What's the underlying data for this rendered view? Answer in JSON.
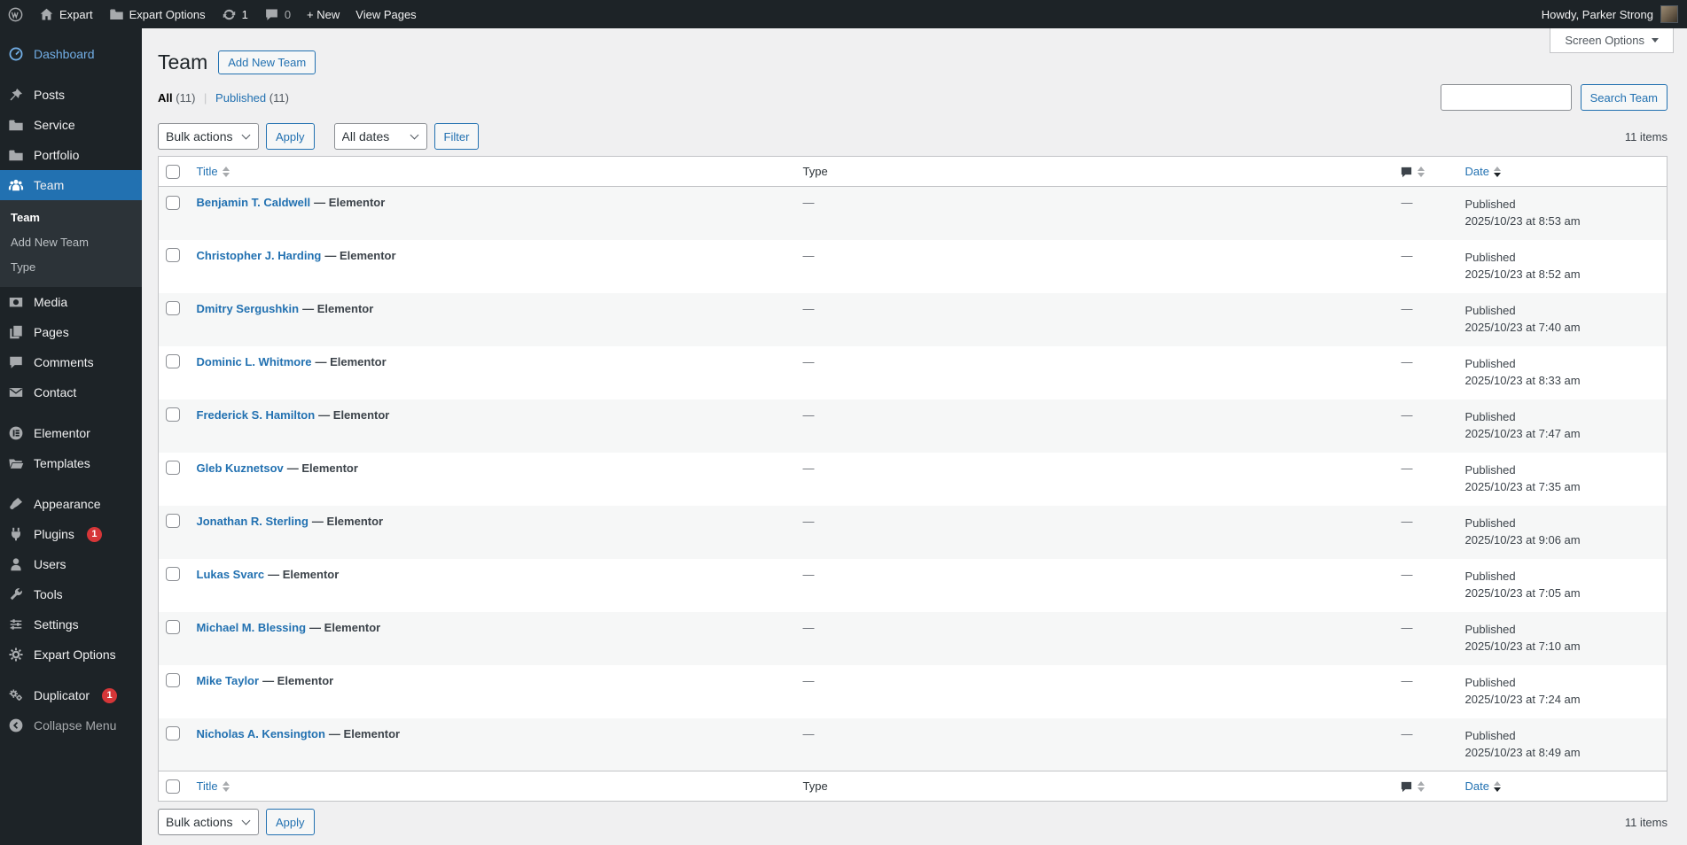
{
  "admin_bar": {
    "site_name": "Expart",
    "site_menu": "Expart Options",
    "update_count": "1",
    "comment_count": "0",
    "new_label": "+ New",
    "view_pages_label": "View Pages",
    "howdy_text": "Howdy, Parker Strong"
  },
  "sidebar": {
    "items": [
      {
        "id": "dashboard",
        "label": "Dashboard",
        "icon": "dashboard-icon",
        "blue": true
      },
      {
        "sep": true
      },
      {
        "id": "posts",
        "label": "Posts",
        "icon": "pushpin-icon"
      },
      {
        "id": "service",
        "label": "Service",
        "icon": "folder-icon"
      },
      {
        "id": "portfolio",
        "label": "Portfolio",
        "icon": "folder-icon"
      },
      {
        "id": "team",
        "label": "Team",
        "icon": "team-icon",
        "active": true,
        "submenu": [
          {
            "label": "Team",
            "current": true
          },
          {
            "label": "Add New Team"
          },
          {
            "label": "Type"
          }
        ]
      },
      {
        "id": "media",
        "label": "Media",
        "icon": "media-icon"
      },
      {
        "id": "pages",
        "label": "Pages",
        "icon": "pages-icon"
      },
      {
        "id": "comments",
        "label": "Comments",
        "icon": "comment-icon"
      },
      {
        "id": "contact",
        "label": "Contact",
        "icon": "envelope-icon"
      },
      {
        "sep": true
      },
      {
        "id": "elementor",
        "label": "Elementor",
        "icon": "elementor-icon"
      },
      {
        "id": "templates",
        "label": "Templates",
        "icon": "folder-open-icon"
      },
      {
        "sep": true
      },
      {
        "id": "appearance",
        "label": "Appearance",
        "icon": "brush-icon"
      },
      {
        "id": "plugins",
        "label": "Plugins",
        "icon": "plug-icon",
        "badge": "1"
      },
      {
        "id": "users",
        "label": "Users",
        "icon": "user-icon"
      },
      {
        "id": "tools",
        "label": "Tools",
        "icon": "wrench-icon"
      },
      {
        "id": "settings",
        "label": "Settings",
        "icon": "sliders-icon"
      },
      {
        "id": "expart-options",
        "label": "Expart Options",
        "icon": "gear-icon"
      },
      {
        "sep": true
      },
      {
        "id": "duplicator",
        "label": "Duplicator",
        "icon": "duplicator-icon",
        "badge": "1"
      },
      {
        "id": "collapse",
        "label": "Collapse Menu",
        "icon": "collapse-icon",
        "muted": true
      }
    ]
  },
  "screen_options": {
    "label": "Screen Options"
  },
  "page": {
    "title": "Team",
    "add_new_label": "Add New Team",
    "views": {
      "all_label": "All",
      "all_count": "(11)",
      "separator": "|",
      "published_label": "Published",
      "published_count": "(11)"
    },
    "search": {
      "button_label": "Search Team"
    },
    "tablenav": {
      "bulk_actions": "Bulk actions",
      "apply": "Apply",
      "all_dates": "All dates",
      "filter": "Filter",
      "items_count": "11 items"
    }
  },
  "table": {
    "columns": {
      "title": "Title",
      "type": "Type",
      "date": "Date"
    },
    "rows": [
      {
        "title": "Benjamin T. Caldwell",
        "state": "— Elementor",
        "type": "—",
        "comments": "—",
        "status": "Published",
        "date": "2025/10/23 at 8:53 am"
      },
      {
        "title": "Christopher J. Harding",
        "state": "— Elementor",
        "type": "—",
        "comments": "—",
        "status": "Published",
        "date": "2025/10/23 at 8:52 am"
      },
      {
        "title": "Dmitry Sergushkin",
        "state": "— Elementor",
        "type": "—",
        "comments": "—",
        "status": "Published",
        "date": "2025/10/23 at 7:40 am"
      },
      {
        "title": "Dominic L. Whitmore",
        "state": "— Elementor",
        "type": "—",
        "comments": "—",
        "status": "Published",
        "date": "2025/10/23 at 8:33 am"
      },
      {
        "title": "Frederick S. Hamilton",
        "state": "— Elementor",
        "type": "—",
        "comments": "—",
        "status": "Published",
        "date": "2025/10/23 at 7:47 am"
      },
      {
        "title": "Gleb Kuznetsov",
        "state": "— Elementor",
        "type": "—",
        "comments": "—",
        "status": "Published",
        "date": "2025/10/23 at 7:35 am"
      },
      {
        "title": "Jonathan R. Sterling",
        "state": "— Elementor",
        "type": "—",
        "comments": "—",
        "status": "Published",
        "date": "2025/10/23 at 9:06 am"
      },
      {
        "title": "Lukas Svarc",
        "state": "— Elementor",
        "type": "—",
        "comments": "—",
        "status": "Published",
        "date": "2025/10/23 at 7:05 am"
      },
      {
        "title": "Michael M. Blessing",
        "state": "— Elementor",
        "type": "—",
        "comments": "—",
        "status": "Published",
        "date": "2025/10/23 at 7:10 am"
      },
      {
        "title": "Mike Taylor",
        "state": "— Elementor",
        "type": "—",
        "comments": "—",
        "status": "Published",
        "date": "2025/10/23 at 7:24 am"
      },
      {
        "title": "Nicholas A. Kensington",
        "state": "— Elementor",
        "type": "—",
        "comments": "—",
        "status": "Published",
        "date": "2025/10/23 at 8:49 am"
      }
    ]
  },
  "colors": {
    "accent": "#2271b1",
    "badge_red": "#d63638",
    "adminbar_bg": "#1d2327",
    "content_bg": "#f0f0f1",
    "stripe": "#f6f7f7",
    "border": "#c3c4c7"
  },
  "icons": {
    "wordpress-logo-icon": "circle-W",
    "home-icon": "house",
    "folder-icon": "closed-folder",
    "update-icon": "circular-arrows",
    "comment-icon": "speech-bubble",
    "dashboard-icon": "gauge",
    "pushpin-icon": "pin",
    "team-icon": "people-group",
    "media-icon": "photo",
    "pages-icon": "stacked-pages",
    "envelope-icon": "envelope",
    "elementor-icon": "circle-E",
    "folder-open-icon": "open-folder",
    "brush-icon": "paintbrush",
    "plug-icon": "plug",
    "user-icon": "person",
    "wrench-icon": "wrench",
    "sliders-icon": "sliders",
    "gear-icon": "gear",
    "duplicator-icon": "gears",
    "collapse-icon": "circle-left-arrow",
    "sort-icon": "up-down-triangles"
  }
}
